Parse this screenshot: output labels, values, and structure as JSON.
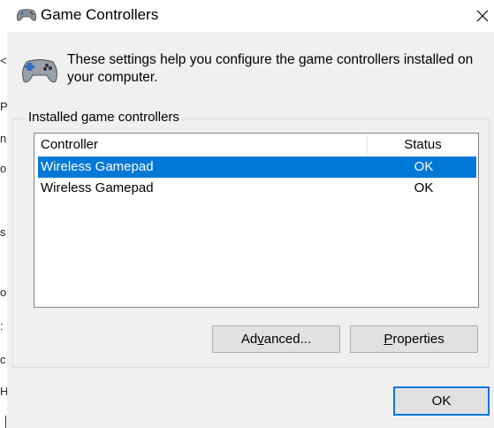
{
  "window": {
    "title": "Game Controllers",
    "icon": "gamepad-icon",
    "close_icon": "close-icon"
  },
  "header": {
    "icon": "gamepad-icon",
    "text": "These settings help you configure the game controllers installed on your computer."
  },
  "group": {
    "label": "Installed game controllers"
  },
  "list": {
    "columns": [
      "Controller",
      "Status"
    ],
    "rows": [
      {
        "controller": "Wireless Gamepad",
        "status": "OK",
        "selected": true
      },
      {
        "controller": "Wireless Gamepad",
        "status": "OK",
        "selected": false
      }
    ]
  },
  "buttons": {
    "advanced_pre": "Ad",
    "advanced_key": "v",
    "advanced_post": "anced...",
    "properties_key": "P",
    "properties_post": "roperties",
    "ok": "OK"
  },
  "colors": {
    "selection": "#0078d7",
    "dialog_bg": "#f0f0f0"
  }
}
